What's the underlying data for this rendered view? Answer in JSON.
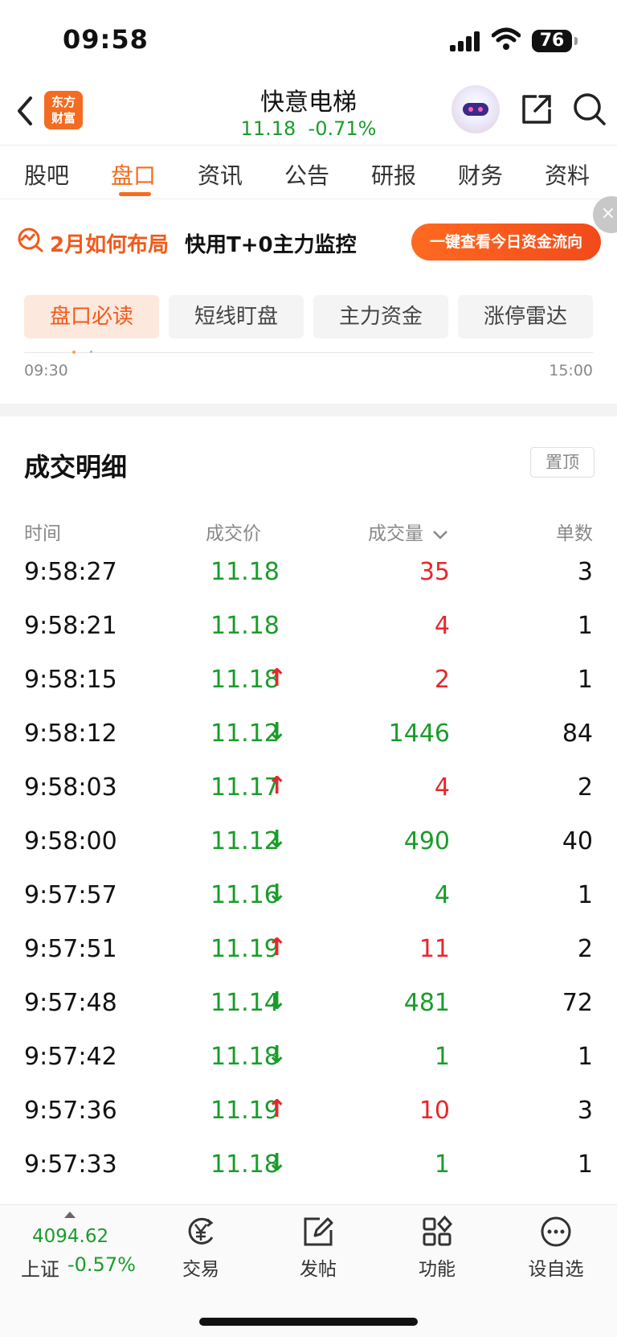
{
  "status": {
    "time": "09:58",
    "battery": "76"
  },
  "header": {
    "logo_text_1": "东方",
    "logo_text_2": "财富",
    "stock_name": "快意电梯",
    "price": "11.18",
    "change": "-0.71%"
  },
  "tabs": [
    "股吧",
    "盘口",
    "资讯",
    "公告",
    "研报",
    "财务",
    "资料"
  ],
  "active_tab": "盘口",
  "banner": {
    "title": "2月如何布局",
    "subtitle": "快用T+0主力监控",
    "button": "一键查看今日资金流向",
    "close": "×"
  },
  "subtabs": [
    "盘口必读",
    "短线盯盘",
    "主力资金",
    "涨停雷达"
  ],
  "chart": {
    "start_time": "09:30",
    "end_time": "15:00"
  },
  "detail": {
    "title": "成交明细",
    "pin": "置顶",
    "columns": [
      "时间",
      "成交价",
      "成交量",
      "单数"
    ],
    "rows": [
      {
        "time": "9:58:27",
        "price": "11.18",
        "arrow": "",
        "volume": "35",
        "vol_color": "red",
        "count": "3"
      },
      {
        "time": "9:58:21",
        "price": "11.18",
        "arrow": "",
        "volume": "4",
        "vol_color": "red",
        "count": "1"
      },
      {
        "time": "9:58:15",
        "price": "11.18",
        "arrow": "↑",
        "volume": "2",
        "vol_color": "red",
        "count": "1"
      },
      {
        "time": "9:58:12",
        "price": "11.12",
        "arrow": "↓",
        "volume": "1446",
        "vol_color": "green",
        "count": "84"
      },
      {
        "time": "9:58:03",
        "price": "11.17",
        "arrow": "↑",
        "volume": "4",
        "vol_color": "red",
        "count": "2"
      },
      {
        "time": "9:58:00",
        "price": "11.12",
        "arrow": "↓",
        "volume": "490",
        "vol_color": "green",
        "count": "40"
      },
      {
        "time": "9:57:57",
        "price": "11.16",
        "arrow": "↓",
        "volume": "4",
        "vol_color": "green",
        "count": "1"
      },
      {
        "time": "9:57:51",
        "price": "11.19",
        "arrow": "↑",
        "volume": "11",
        "vol_color": "red",
        "count": "2"
      },
      {
        "time": "9:57:48",
        "price": "11.14",
        "arrow": "↓",
        "volume": "481",
        "vol_color": "green",
        "count": "72"
      },
      {
        "time": "9:57:42",
        "price": "11.18",
        "arrow": "↓",
        "volume": "1",
        "vol_color": "green",
        "count": "1"
      },
      {
        "time": "9:57:36",
        "price": "11.19",
        "arrow": "↑",
        "volume": "10",
        "vol_color": "red",
        "count": "3"
      },
      {
        "time": "9:57:33",
        "price": "11.18",
        "arrow": "↓",
        "volume": "1",
        "vol_color": "green",
        "count": "1"
      }
    ]
  },
  "bottom": {
    "index_value": "4094.62",
    "index_name": "上证",
    "index_change": "-0.57%",
    "nav": [
      "交易",
      "发帖",
      "功能",
      "设自选"
    ]
  },
  "colors": {
    "accent": "#f36c21",
    "up": "#e8262b",
    "down": "#1a9c2b"
  }
}
